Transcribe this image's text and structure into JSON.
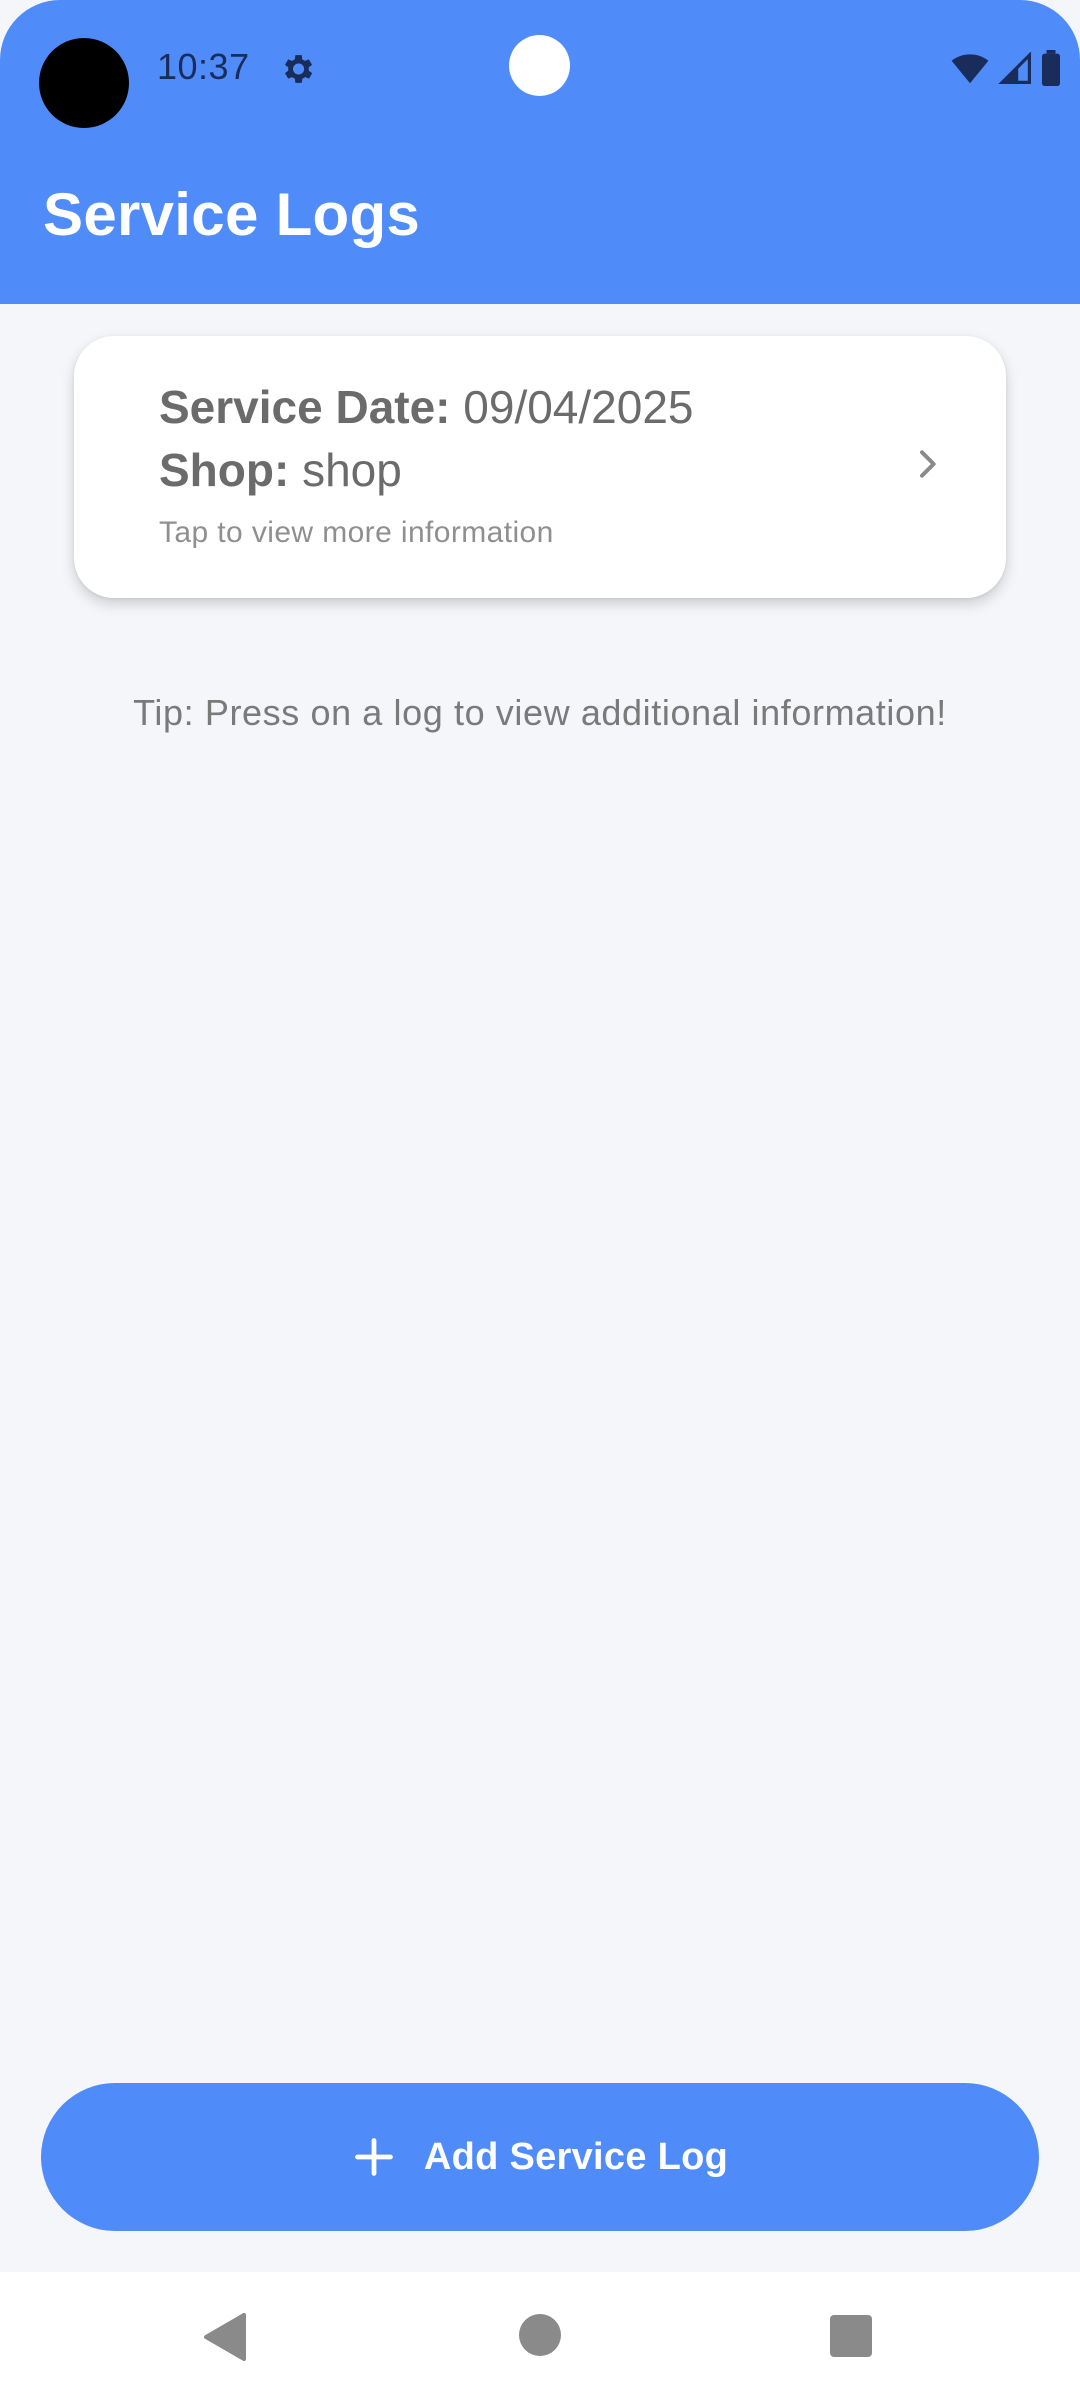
{
  "status_bar": {
    "time": "10:37",
    "icons": [
      "settings-gear-icon",
      "wifi-icon",
      "cellular-signal-icon",
      "battery-icon"
    ]
  },
  "app_bar": {
    "title": "Service Logs"
  },
  "logs": [
    {
      "date_label": "Service Date:",
      "date_value": "09/04/2025",
      "shop_label": "Shop:",
      "shop_value": "shop",
      "hint": "Tap to view more information"
    }
  ],
  "tip": "Tip: Press on a log to view additional information!",
  "add_button": {
    "label": "Add Service Log",
    "icon": "plus-icon"
  },
  "nav_bar": {
    "icons": [
      "back-icon",
      "home-icon",
      "recents-icon"
    ]
  },
  "colors": {
    "primary": "#4f8cfa",
    "background": "#f4f6fa",
    "card": "#ffffff",
    "text_dark": "#6b6b6b",
    "text_muted": "#8f8f8f"
  }
}
